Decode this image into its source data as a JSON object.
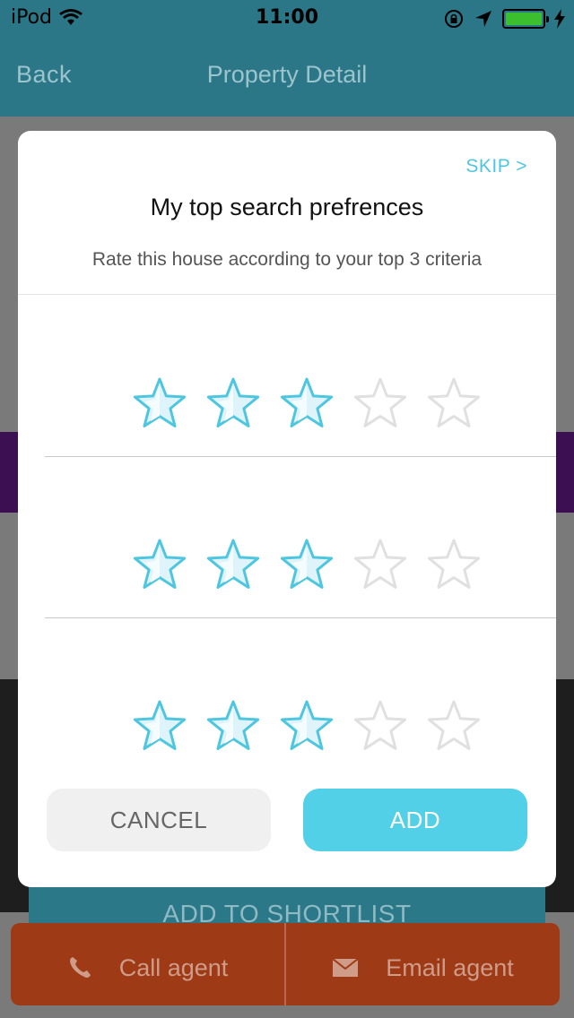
{
  "status_bar": {
    "carrier": "iPod",
    "time": "11:00",
    "battery_level": 1.0
  },
  "nav": {
    "back_label": "Back",
    "title": "Property Detail"
  },
  "modal": {
    "skip_label": "SKIP >",
    "title": "My top search prefrences",
    "subtitle": "Rate this house according to your top 3 criteria",
    "ratings": [
      {
        "value": 3,
        "max": 5
      },
      {
        "value": 3,
        "max": 5
      },
      {
        "value": 3,
        "max": 5
      }
    ],
    "cancel_label": "CANCEL",
    "add_label": "ADD"
  },
  "background": {
    "shortlist_label": "ADD TO SHORTLIST",
    "call_label": "Call agent",
    "email_label": "Email agent"
  },
  "colors": {
    "accent": "#52d0e8",
    "star_filled_stroke": "#4ec6e0",
    "star_empty_stroke": "#e0e0e0",
    "nav_background": "#2b7787",
    "agent_bar": "#9e3a15"
  },
  "icons": {
    "wifi": "wifi-icon",
    "location": "location-arrow-icon",
    "orientation_lock": "orientation-lock-icon",
    "charging": "charging-bolt-icon",
    "phone": "phone-icon",
    "mail": "mail-icon",
    "star": "star-icon"
  }
}
